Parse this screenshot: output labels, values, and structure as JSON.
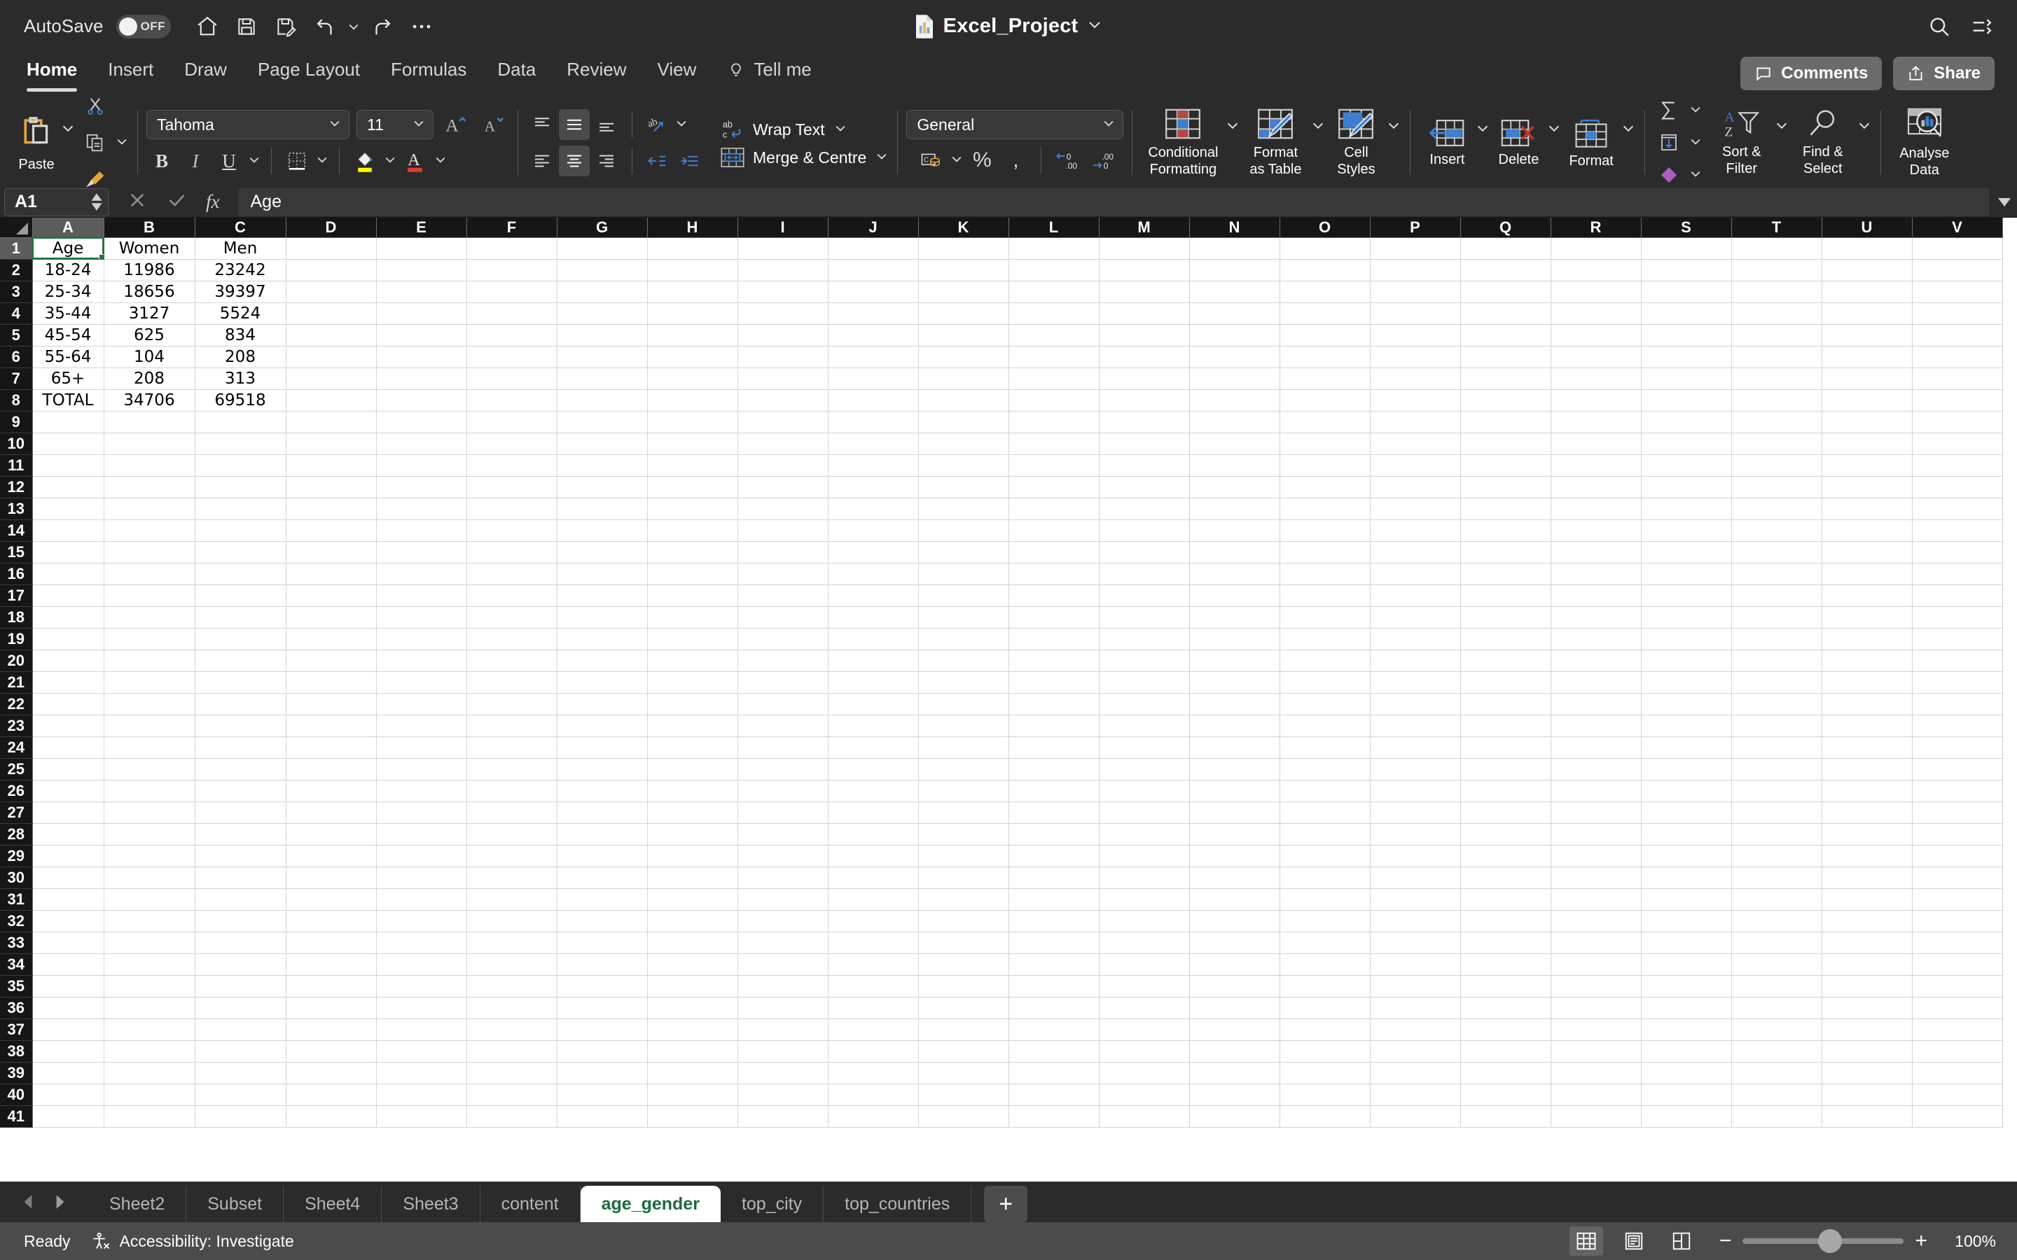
{
  "titlebar": {
    "autosave_label": "AutoSave",
    "autosave_state": "OFF",
    "doc_title": "Excel_Project",
    "quick_access": [
      {
        "name": "home-icon",
        "label": "Home"
      },
      {
        "name": "save-icon",
        "label": "Save"
      },
      {
        "name": "save-as-icon",
        "label": "Save As"
      },
      {
        "name": "undo-icon",
        "label": "Undo"
      },
      {
        "name": "redo-icon",
        "label": "Redo"
      },
      {
        "name": "more-options-icon",
        "label": "More"
      }
    ],
    "search_label": "Search",
    "ribbon_display_label": "Ribbon Display Options"
  },
  "ribbon_tabs": {
    "items": [
      {
        "label": "Home",
        "active": true
      },
      {
        "label": "Insert",
        "active": false
      },
      {
        "label": "Draw",
        "active": false
      },
      {
        "label": "Page Layout",
        "active": false
      },
      {
        "label": "Formulas",
        "active": false
      },
      {
        "label": "Data",
        "active": false
      },
      {
        "label": "Review",
        "active": false
      },
      {
        "label": "View",
        "active": false
      }
    ],
    "tell_me": "Tell me",
    "comments": "Comments",
    "share": "Share"
  },
  "ribbon": {
    "paste_label": "Paste",
    "cut_label": "Cut",
    "copy_label": "Copy",
    "format_painter_label": "Format Painter",
    "font_name": "Tahoma",
    "font_size": "11",
    "grow_font_label": "Increase Font Size",
    "shrink_font_label": "Decrease Font Size",
    "bold_label": "B",
    "italic_label": "I",
    "underline_label": "U",
    "borders_label": "Borders",
    "fill_color_label": "Fill Colour",
    "font_color_label": "Font Colour",
    "wrap_text": "Wrap Text",
    "merge_centre": "Merge & Centre",
    "orientation_label": "Orientation",
    "number_format": "General",
    "accounting_label": "Accounting Number Format",
    "percent_label": "Percent Style",
    "comma_label": "Comma Style",
    "increase_decimal_label": "Increase Decimal",
    "decrease_decimal_label": "Decrease Decimal",
    "conditional_formatting": "Conditional\nFormatting",
    "conditional_formatting_l1": "Conditional",
    "conditional_formatting_l2": "Formatting",
    "format_as_table_l1": "Format",
    "format_as_table_l2": "as Table",
    "cell_styles_l1": "Cell",
    "cell_styles_l2": "Styles",
    "insert_label": "Insert",
    "delete_label": "Delete",
    "format_label": "Format",
    "autosum_label": "AutoSum",
    "fill_label": "Fill",
    "clear_label": "Clear",
    "sort_filter_l1": "Sort &",
    "sort_filter_l2": "Filter",
    "find_select_l1": "Find &",
    "find_select_l2": "Select",
    "analyse_data_l1": "Analyse",
    "analyse_data_l2": "Data",
    "accent_blue": "#3f7fd0",
    "accent_orange": "#e8a33d",
    "accent_red": "#c0392b",
    "accent_yellow": "#ffff00",
    "accent_purple": "#b05ac8"
  },
  "formula_bar": {
    "name_box": "A1",
    "cancel_label": "Cancel",
    "enter_label": "Enter",
    "fx_label": "fx",
    "formula_value": "Age"
  },
  "grid": {
    "columns": [
      "A",
      "B",
      "C",
      "D",
      "E",
      "F",
      "G",
      "H",
      "I",
      "J",
      "K",
      "L",
      "M",
      "N",
      "O",
      "P",
      "Q",
      "R",
      "S",
      "T",
      "U",
      "V"
    ],
    "selected_column": "A",
    "selected_row": 1,
    "active_cell": "A1",
    "row_count": 41,
    "rows": [
      {
        "n": 1,
        "cells": [
          "Age",
          "Women",
          "Men"
        ]
      },
      {
        "n": 2,
        "cells": [
          "18-24",
          "11986",
          "23242"
        ]
      },
      {
        "n": 3,
        "cells": [
          "25-34",
          "18656",
          "39397"
        ]
      },
      {
        "n": 4,
        "cells": [
          "35-44",
          "3127",
          "5524"
        ]
      },
      {
        "n": 5,
        "cells": [
          "45-54",
          "625",
          "834"
        ]
      },
      {
        "n": 6,
        "cells": [
          "55-64",
          "104",
          "208"
        ]
      },
      {
        "n": 7,
        "cells": [
          "65+",
          "208",
          "313"
        ]
      },
      {
        "n": 8,
        "cells": [
          "TOTAL",
          "34706",
          "69518"
        ]
      }
    ]
  },
  "table_data": {
    "headers": [
      "Age",
      "Women",
      "Men"
    ],
    "rows": [
      [
        "18-24",
        11986,
        23242
      ],
      [
        "25-34",
        18656,
        39397
      ],
      [
        "35-44",
        3127,
        5524
      ],
      [
        "45-54",
        625,
        834
      ],
      [
        "55-64",
        104,
        208
      ],
      [
        "65+",
        208,
        313
      ],
      [
        "TOTAL",
        34706,
        69518
      ]
    ]
  },
  "sheet_tabs": {
    "items": [
      {
        "label": "Sheet2",
        "active": false
      },
      {
        "label": "Subset",
        "active": false
      },
      {
        "label": "Sheet4",
        "active": false
      },
      {
        "label": "Sheet3",
        "active": false
      },
      {
        "label": "content",
        "active": false
      },
      {
        "label": "age_gender",
        "active": true
      },
      {
        "label": "top_city",
        "active": false
      },
      {
        "label": "top_countries",
        "active": false
      }
    ],
    "add_label": "+",
    "prev_label": "Previous Sheet",
    "next_label": "Next Sheet"
  },
  "status_bar": {
    "state": "Ready",
    "accessibility": "Accessibility: Investigate",
    "views": [
      {
        "name": "normal-view-icon",
        "active": true
      },
      {
        "name": "page-layout-view-icon",
        "active": false
      },
      {
        "name": "page-break-view-icon",
        "active": false
      }
    ],
    "zoom_out": "−",
    "zoom_in": "+",
    "zoom_level": "100%"
  }
}
